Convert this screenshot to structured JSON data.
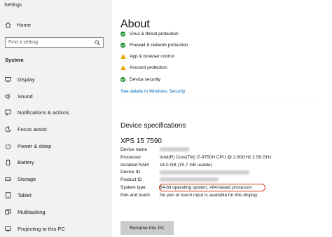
{
  "window": {
    "title": "Settings"
  },
  "sidebar": {
    "home_label": "Home",
    "search": {
      "placeholder": "Find a setting"
    },
    "section_label": "System",
    "items": [
      {
        "label": "Display",
        "icon": "display-icon"
      },
      {
        "label": "Sound",
        "icon": "sound-icon"
      },
      {
        "label": "Notifications & actions",
        "icon": "notifications-icon"
      },
      {
        "label": "Focus assist",
        "icon": "focus-assist-icon"
      },
      {
        "label": "Power & sleep",
        "icon": "power-icon"
      },
      {
        "label": "Battery",
        "icon": "battery-icon"
      },
      {
        "label": "Storage",
        "icon": "storage-icon"
      },
      {
        "label": "Tablet",
        "icon": "tablet-icon"
      },
      {
        "label": "Multitasking",
        "icon": "multitasking-icon"
      },
      {
        "label": "Projecting to this PC",
        "icon": "projecting-icon"
      }
    ]
  },
  "main": {
    "title": "About",
    "security": {
      "items": [
        {
          "label": "Virus & threat protection",
          "status": "ok"
        },
        {
          "label": "Firewall & network protection",
          "status": "ok"
        },
        {
          "label": "App & browser control",
          "status": "warning"
        },
        {
          "label": "Account protection",
          "status": "warning"
        },
        {
          "label": "Device security",
          "status": "ok"
        }
      ],
      "link_label": "See details in Windows Security"
    },
    "specs": {
      "heading": "Device specifications",
      "device_name_display": "XPS 15 7590",
      "rows": {
        "device_name": {
          "label": "Device name"
        },
        "processor": {
          "label": "Processor",
          "value": "Intel(R) Core(TM) i7-9750H CPU @ 2.60GHz   2.59 GHz"
        },
        "ram": {
          "label": "Installed RAM",
          "value": "16.0 GB (15.7 GB usable)"
        },
        "device_id": {
          "label": "Device ID"
        },
        "product_id": {
          "label": "Product ID"
        },
        "system_type": {
          "label": "System type",
          "value": "64-bit operating system, x64-based processor"
        },
        "pen_touch": {
          "label": "Pen and touch",
          "value": "No pen or touch input is available for this display"
        }
      },
      "rename_button_label": "Rename this PC"
    }
  },
  "colors": {
    "link": "#0067b8",
    "ok": "#128a28",
    "warning": "#e8a800",
    "highlight": "#d23a1c"
  }
}
